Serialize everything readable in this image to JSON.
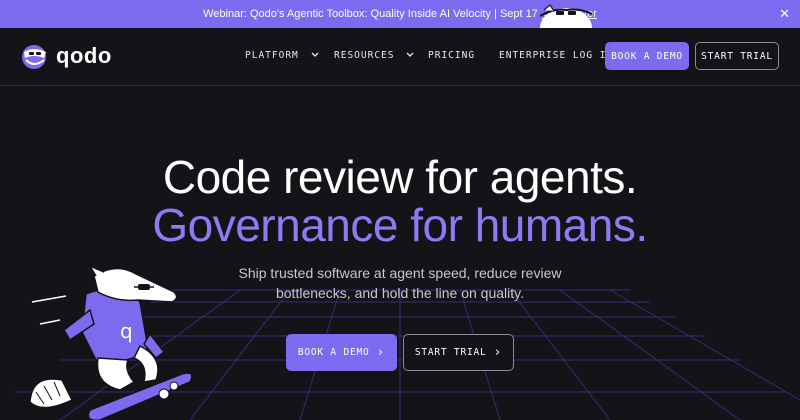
{
  "banner": {
    "message": "Webinar: Qodo's Agentic Toolbox: Quality Inside AI Velocity | Sept 17",
    "register": "→ Register",
    "close": "✕"
  },
  "header": {
    "logo_text": "qodo",
    "nav": [
      {
        "label": "PLATFORM",
        "dropdown": true
      },
      {
        "label": "RESOURCES",
        "dropdown": true
      },
      {
        "label": "PRICING",
        "dropdown": false
      },
      {
        "label": "ENTERPRISE LOG IN",
        "dropdown": false
      }
    ],
    "book_demo": "BOOK A DEMO",
    "start_trial": "START TRIAL"
  },
  "hero": {
    "title_line1": "Code review for agents.",
    "title_line2": "Governance for humans.",
    "subtitle_line1": "Ship trusted software at agent speed, reduce review",
    "subtitle_line2": "bottlenecks, and hold the line on quality.",
    "cta_demo": "BOOK A DEMO",
    "cta_trial": "START TRIAL",
    "cta_arrow": "›"
  },
  "colors": {
    "accent": "#7d6bef",
    "headline_purple": "#8b7cf3",
    "background": "#141317",
    "grid": "#4a3aa8"
  },
  "icons": [
    "close-icon",
    "chevron-down-icon",
    "chevron-right-icon",
    "logo-mascot-icon",
    "anteater-skater-illustration",
    "mascot-peek-icon"
  ]
}
